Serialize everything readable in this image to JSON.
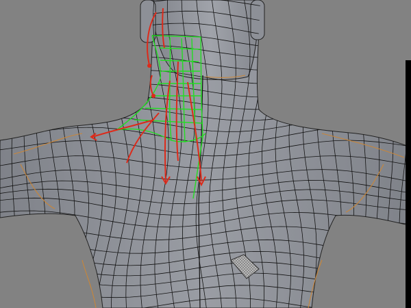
{
  "viewport": {
    "background": "#828282",
    "mesh_surface_color": "#8c8f96",
    "mesh_wire_color": "#111111",
    "seam_edge_color": "#c8863a",
    "selection_color": "#22dd22",
    "annotation_color": "#dd2a1a",
    "selected_face_color": "#b4b4b4"
  },
  "scene": {
    "object": "character-upper-body-back",
    "view": "back"
  }
}
